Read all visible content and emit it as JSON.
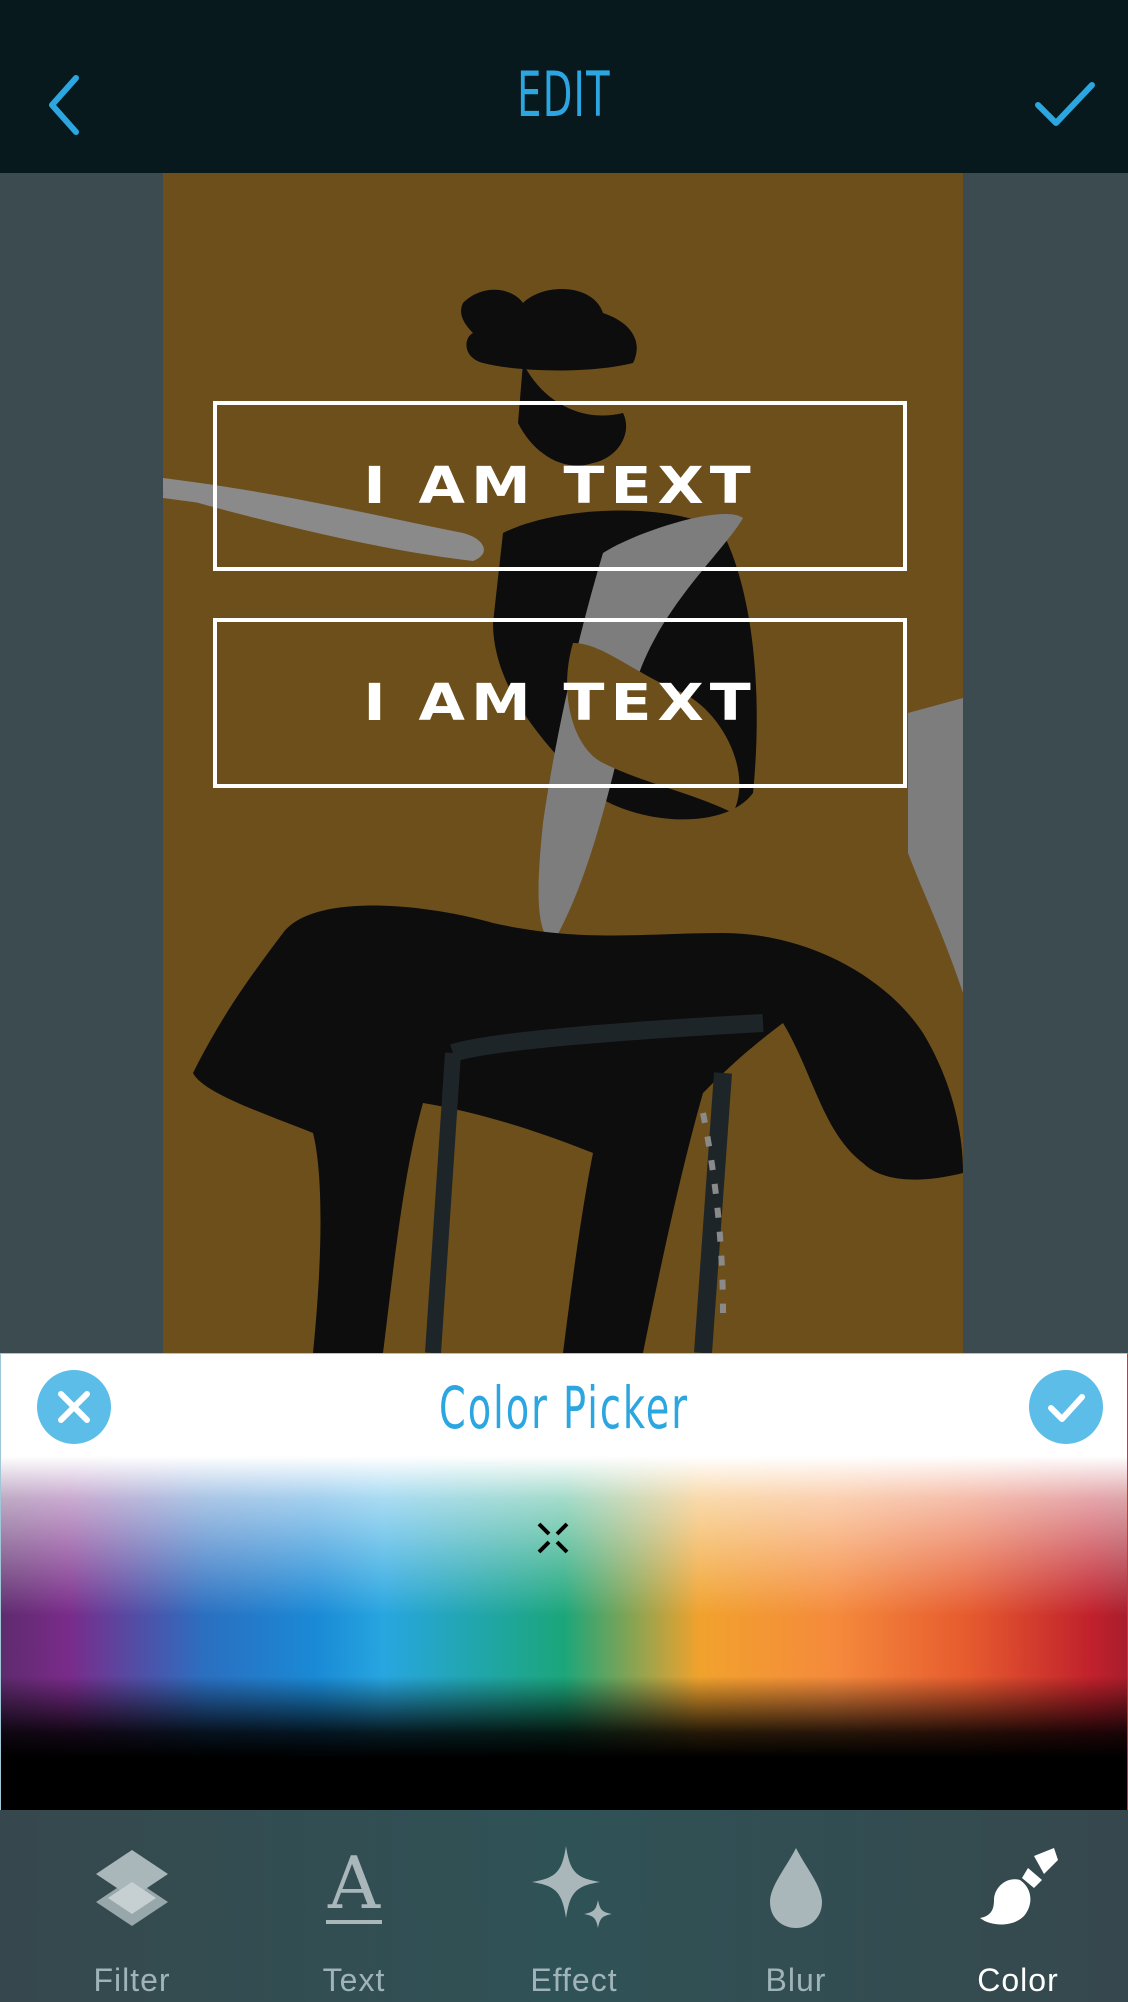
{
  "header": {
    "title": "EDIT",
    "back_icon": "chevron-left-icon",
    "confirm_icon": "checkmark-icon",
    "accent_color": "#2ba6e0"
  },
  "canvas": {
    "background_color": "#6d4f1b",
    "text_layers": [
      {
        "text": "I AM TEXT"
      },
      {
        "text": "I AM TEXT"
      }
    ]
  },
  "color_picker": {
    "title": "Color Picker",
    "cancel_icon": "close-icon",
    "apply_icon": "checkmark-icon"
  },
  "bottom_nav": {
    "items": [
      {
        "label": "Filter",
        "icon": "layers-icon",
        "active": false
      },
      {
        "label": "Text",
        "icon": "text-a-icon",
        "active": false
      },
      {
        "label": "Effect",
        "icon": "sparkle-icon",
        "active": false
      },
      {
        "label": "Blur",
        "icon": "droplet-icon",
        "active": false
      },
      {
        "label": "Color",
        "icon": "paint-brush-icon",
        "active": true
      }
    ]
  }
}
